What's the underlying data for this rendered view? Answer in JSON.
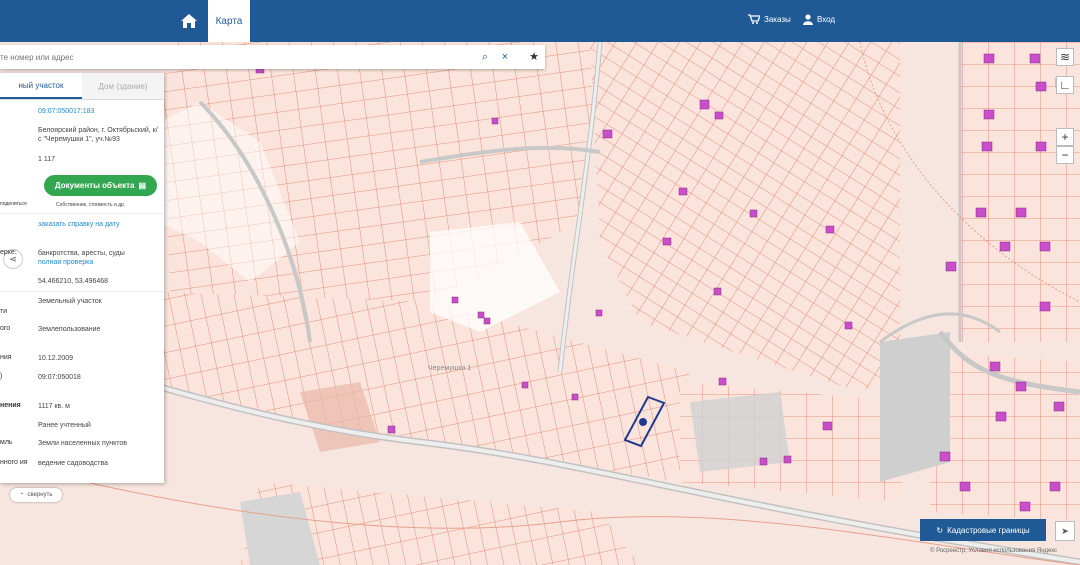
{
  "header": {
    "map_tab": "Карта",
    "orders": "Заказы",
    "login": "Вход"
  },
  "search": {
    "placeholder": "те номер или адрес",
    "search_icon": "search-icon",
    "clear_icon": "close-icon",
    "favorite_icon": "star-icon"
  },
  "panel": {
    "tab_land": "ный участок",
    "tab_building": "Дом (здание)",
    "cadastral_number": "09:07:050017:183",
    "address": "Белоярский район, г. Октябрьский, к/с \"Черемушки 1\", уч.№93",
    "area_value": "1 117",
    "share_label": "поделиться",
    "docs_button": "Документы объекта",
    "docs_caption": "Собственник, стоимость и др.",
    "order_link": "заказать справку на дату",
    "check_label": "ерке:",
    "check_value": "банкротства, аресты, суды",
    "check_link": "полная проверка",
    "coords": "54.466210, 53.496468",
    "type_label": "ти",
    "type_value": "Земельный участок",
    "kind_label": "ого",
    "kind_value": "Землепользование",
    "date_label": "ния",
    "date_value": "10.12.2009",
    "quarter_label": ")",
    "quarter_value": "09:07:050018",
    "area_label": "нения",
    "area_full": "1117 кв. м",
    "status_value": "Ранее учтенный",
    "category_label": "мль",
    "category_value": "Земли населенных пунктов",
    "use_label": "нного ия",
    "use_value": "ведение садоводства",
    "hide_button": "свернуть"
  },
  "map": {
    "street_label": "Черемушки 1",
    "zoom_in": "+",
    "zoom_out": "−",
    "layers_icon": "layers-icon",
    "ruler_icon": "ruler-icon"
  },
  "cadastral_button": "Кадастровые границы",
  "copyright": "© Росреестр, Условия использования Яндекс"
}
